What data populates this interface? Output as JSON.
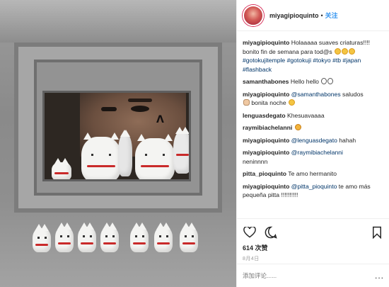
{
  "post": {
    "username": "miyagipioquinto",
    "separator": "•",
    "follow_label": "关注"
  },
  "comments": [
    {
      "user": "miyagipioquinto",
      "text": "Holaaaaa suaves criaturas!!!! bonito fin de semana para tod@s",
      "hashtags": "#gotokujitemple #gotokuji #tokyo #tb #japan #flashback"
    },
    {
      "user": "samanthabones",
      "text": "Hello hello"
    },
    {
      "user": "miyagipioquinto",
      "mention": "@samanthabones",
      "text": "saludos",
      "text2": "bonita noche"
    },
    {
      "user": "lenguasdegato",
      "text": "Khesuavaaaa"
    },
    {
      "user": "raymibiachelanni",
      "text": ""
    },
    {
      "user": "miyagipioquinto",
      "mention": "@lenguasdegato",
      "text": "hahah"
    },
    {
      "user": "miyagipioquinto",
      "mention": "@raymibiachelanni",
      "text": "neninnnn"
    },
    {
      "user": "pitta_pioquinto",
      "text": "Te amo hermanito"
    },
    {
      "user": "miyagipioquinto",
      "mention": "@pitta_pioquinto",
      "text": "te amo más pequeña pitta !!!!!!!!!!"
    }
  ],
  "actions": {
    "likes": "614 次赞",
    "date": "8月4日",
    "icons": [
      "heart-icon",
      "comment-icon",
      "bookmark-icon"
    ]
  },
  "add_comment": {
    "placeholder": "添加评论......",
    "more": "..."
  },
  "colors": {
    "link": "#003569",
    "follow": "#3897f0",
    "text": "#262626"
  }
}
